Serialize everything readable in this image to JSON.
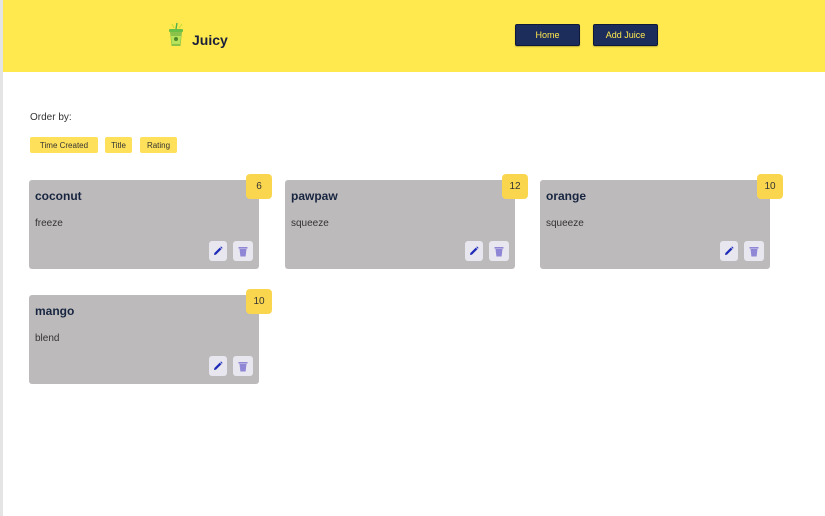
{
  "header": {
    "brand": "Juicy",
    "nav": {
      "home_label": "Home",
      "add_label": "Add Juice"
    }
  },
  "sort": {
    "label": "Order by:",
    "options": [
      "Time Created",
      "Title",
      "Rating"
    ]
  },
  "juices": [
    {
      "title": "coconut",
      "method": "freeze",
      "rating": "6"
    },
    {
      "title": "pawpaw",
      "method": "squeeze",
      "rating": "12"
    },
    {
      "title": "orange",
      "method": "squeeze",
      "rating": "10"
    },
    {
      "title": "mango",
      "method": "blend",
      "rating": "10"
    }
  ],
  "colors": {
    "header_bg": "#ffe94e",
    "nav_bg": "#1d2d5b",
    "card_bg": "#bdbabb",
    "badge_bg": "#fad64f",
    "edit_icon": "#1f2bb8",
    "delete_icon": "#8f86d6"
  },
  "icons": {
    "logo": "juice-cup-icon",
    "edit": "pencil-icon",
    "delete": "trash-icon"
  }
}
